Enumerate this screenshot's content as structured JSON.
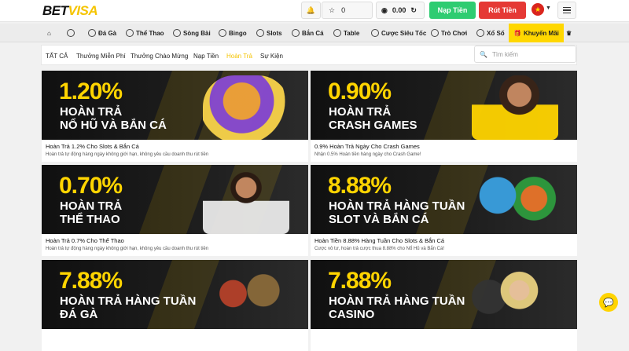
{
  "header": {
    "logo_a": "BET",
    "logo_b": "VISA",
    "coins": "0",
    "balance": "0.00",
    "deposit_label": "Nạp Tiền",
    "withdraw_label": "Rút Tiền"
  },
  "nav": [
    {
      "label": ""
    },
    {
      "label": ""
    },
    {
      "label": "Đá Gà"
    },
    {
      "label": "Thể Thao"
    },
    {
      "label": "Sòng Bài"
    },
    {
      "label": "Bingo"
    },
    {
      "label": "Slots"
    },
    {
      "label": "Bắn Cá"
    },
    {
      "label": "Table"
    },
    {
      "label": "Cược Siêu Tốc"
    },
    {
      "label": "Trò Chơi"
    },
    {
      "label": "Xổ Số"
    },
    {
      "label": "Khuyến Mãi"
    },
    {
      "label": ""
    }
  ],
  "filters": [
    "TẤT CẢ",
    "Thưởng Miễn Phí",
    "Thưởng Chào Mừng",
    "Nạp Tiền",
    "Hoàn Trả",
    "Sự Kiện"
  ],
  "search_placeholder": "Tìm kiếm",
  "promos": [
    {
      "percent": "1.20%",
      "banner_title": "HOÀN TRẢ\nNỔ HŨ VÀ BẮN CÁ",
      "title": "Hoàn Trả 1.2% Cho Slots & Bắn Cá",
      "desc": "Hoàn trả tự động hàng ngày không giới hạn, không yêu cầu doanh thu rút tiền"
    },
    {
      "percent": "0.90%",
      "banner_title": "HOÀN TRẢ\nCRASH GAMES",
      "title": "0.9% Hoàn Trả Ngày Cho Crash Games",
      "desc": "Nhận 0.5% Hoàn tiền hàng ngày cho Crash Game!"
    },
    {
      "percent": "0.70%",
      "banner_title": "HOÀN TRẢ\nTHỂ THAO",
      "title": "Hoàn Trả 0.7% Cho Thể Thao",
      "desc": "Hoàn trả tự động hàng ngày không giới hạn, không yêu cầu doanh thu rút tiền"
    },
    {
      "percent": "8.88%",
      "banner_title": "HOÀN TRẢ HÀNG TUẦN\nSLOT VÀ BẮN CÁ",
      "title": "Hoàn Tiền 8.88% Hàng Tuần Cho Slots & Bắn Cá",
      "desc": "Cược vô tư, hoàn trả cược thua 8.88% cho Nổ Hũ và Bắn Cá!"
    },
    {
      "percent": "7.88%",
      "banner_title": "HOÀN TRẢ HÀNG TUẦN\nĐÁ GÀ",
      "title": "",
      "desc": ""
    },
    {
      "percent": "7.88%",
      "banner_title": "HOÀN TRẢ HÀNG TUẦN\nCASINO",
      "title": "",
      "desc": ""
    }
  ],
  "colors": {
    "accent": "#ffd400",
    "deposit": "#2ecc71",
    "withdraw": "#e53935"
  }
}
